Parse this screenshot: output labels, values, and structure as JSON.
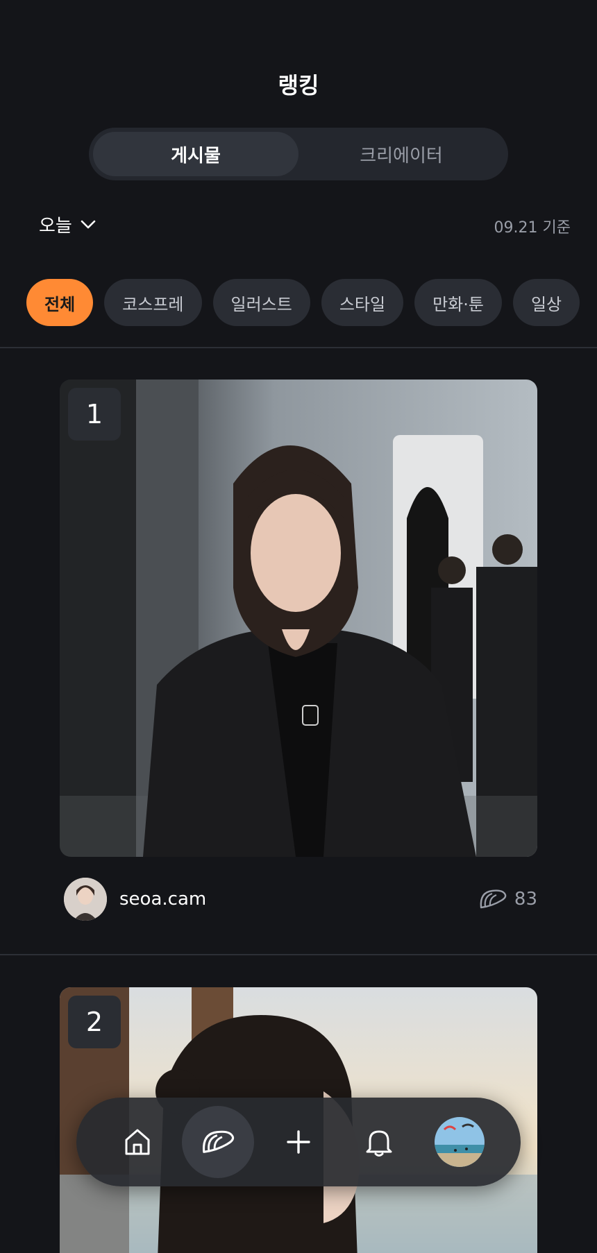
{
  "header": {
    "title": "랭킹"
  },
  "segment": {
    "tabs": [
      "게시물",
      "크리에이터"
    ],
    "active": 0
  },
  "filter": {
    "period": "오늘",
    "basis": "09.21 기준"
  },
  "categories": [
    "전체",
    "코스프레",
    "일러스트",
    "스타일",
    "만화·툰",
    "일상"
  ],
  "posts": [
    {
      "rank": "1",
      "username": "seoa.cam",
      "likes": "83"
    },
    {
      "rank": "2"
    }
  ],
  "icons": {
    "home": "home-icon",
    "feed": "taco-icon",
    "create": "plus-icon",
    "notifications": "bell-icon",
    "profile": "profile-avatar"
  },
  "colors": {
    "accent": "#ff8a34",
    "background": "#141519",
    "chip": "#2a2d34"
  }
}
